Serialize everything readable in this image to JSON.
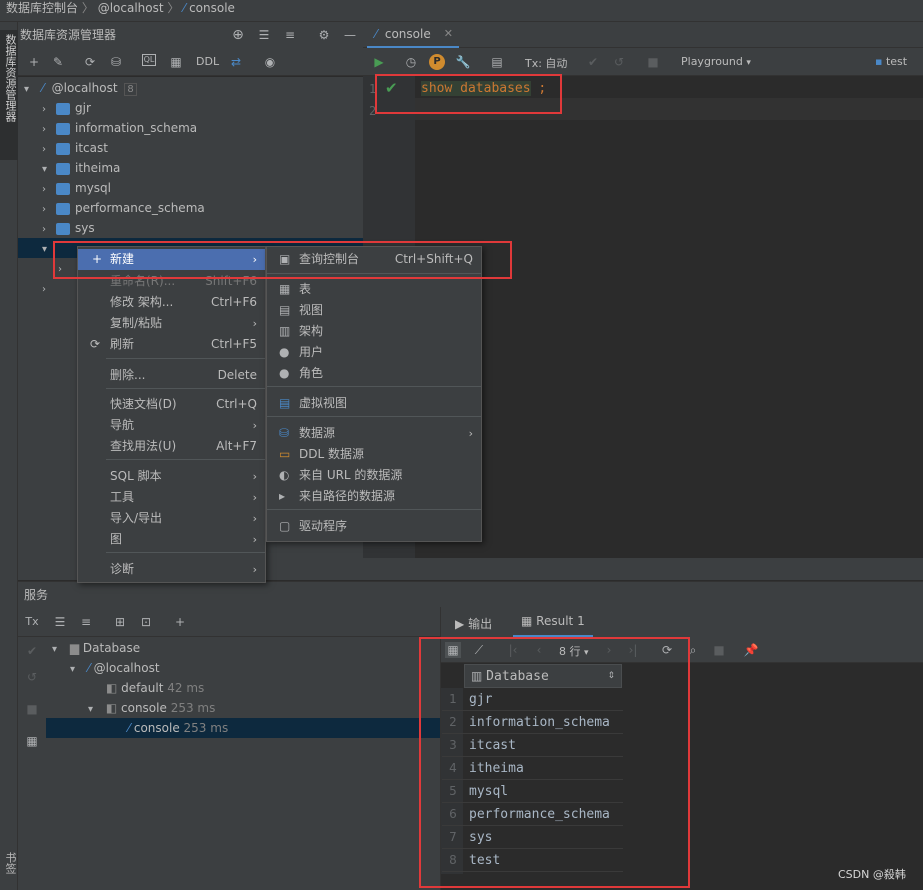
{
  "breadcrumb": {
    "item1": "数据库控制台",
    "sep": "〉",
    "item2": "@localhost",
    "item3": "console"
  },
  "explorer": {
    "title": "数据库资源管理器",
    "side_label": "数据库资源管理器",
    "toolbar_ddl": "DDL",
    "root": {
      "label": "@localhost",
      "count": "8"
    },
    "schemas": [
      "gjr",
      "information_schema",
      "itcast",
      "itheima",
      "mysql",
      "performance_schema",
      "sys"
    ]
  },
  "editor": {
    "tab": "console",
    "tx_label": "Tx: 自动",
    "playground": "Playground",
    "schema_selector": "test",
    "line_numbers": [
      "1",
      "2"
    ],
    "code_keyword": "show databases",
    "code_semicolon": ";"
  },
  "context_menu": {
    "items": [
      {
        "label": "新建",
        "shortcut": ""
      },
      {
        "label": "重命名(R)...",
        "shortcut": "Shift+F6"
      },
      {
        "label": "修改 架构...",
        "shortcut": "Ctrl+F6"
      },
      {
        "label": "复制/粘贴",
        "shortcut": ""
      },
      {
        "label": "刷新",
        "shortcut": "Ctrl+F5"
      },
      {
        "label": "删除...",
        "shortcut": "Delete"
      },
      {
        "label": "快速文档(D)",
        "shortcut": "Ctrl+Q"
      },
      {
        "label": "导航",
        "shortcut": ""
      },
      {
        "label": "查找用法(U)",
        "shortcut": "Alt+F7"
      },
      {
        "label": "SQL 脚本",
        "shortcut": ""
      },
      {
        "label": "工具",
        "shortcut": ""
      },
      {
        "label": "导入/导出",
        "shortcut": ""
      },
      {
        "label": "图",
        "shortcut": ""
      },
      {
        "label": "诊断",
        "shortcut": ""
      }
    ]
  },
  "submenu": {
    "items": [
      {
        "label": "查询控制台",
        "shortcut": "Ctrl+Shift+Q"
      },
      {
        "label": "表",
        "shortcut": ""
      },
      {
        "label": "视图",
        "shortcut": ""
      },
      {
        "label": "架构",
        "shortcut": ""
      },
      {
        "label": "用户",
        "shortcut": ""
      },
      {
        "label": "角色",
        "shortcut": ""
      },
      {
        "label": "虚拟视图",
        "shortcut": ""
      },
      {
        "label": "数据源",
        "shortcut": ""
      },
      {
        "label": "DDL 数据源",
        "shortcut": ""
      },
      {
        "label": "来自 URL 的数据源",
        "shortcut": ""
      },
      {
        "label": "来自路径的数据源",
        "shortcut": ""
      },
      {
        "label": "驱动程序",
        "shortcut": ""
      }
    ]
  },
  "services": {
    "title": "服务",
    "tree": {
      "database": "Database",
      "localhost": "@localhost",
      "default": "default",
      "default_time": "42 ms",
      "console_group": "console",
      "console_group_time": "253 ms",
      "console": "console",
      "console_time": "253 ms"
    },
    "bookmarks_label": "书签"
  },
  "results": {
    "tab_output": "输出",
    "tab_result": "Result 1",
    "rows_label": "8 行",
    "column": "Database",
    "rows": [
      "gjr",
      "information_schema",
      "itcast",
      "itheima",
      "mysql",
      "performance_schema",
      "sys",
      "test"
    ],
    "row_numbers": [
      "1",
      "2",
      "3",
      "4",
      "5",
      "6",
      "7",
      "8"
    ]
  },
  "watermark": "CSDN @殺韩",
  "colors": {
    "accent": "#4a88c7",
    "highlight_box": "#e0393a",
    "keyword": "#cc7832",
    "check": "#499c54"
  }
}
